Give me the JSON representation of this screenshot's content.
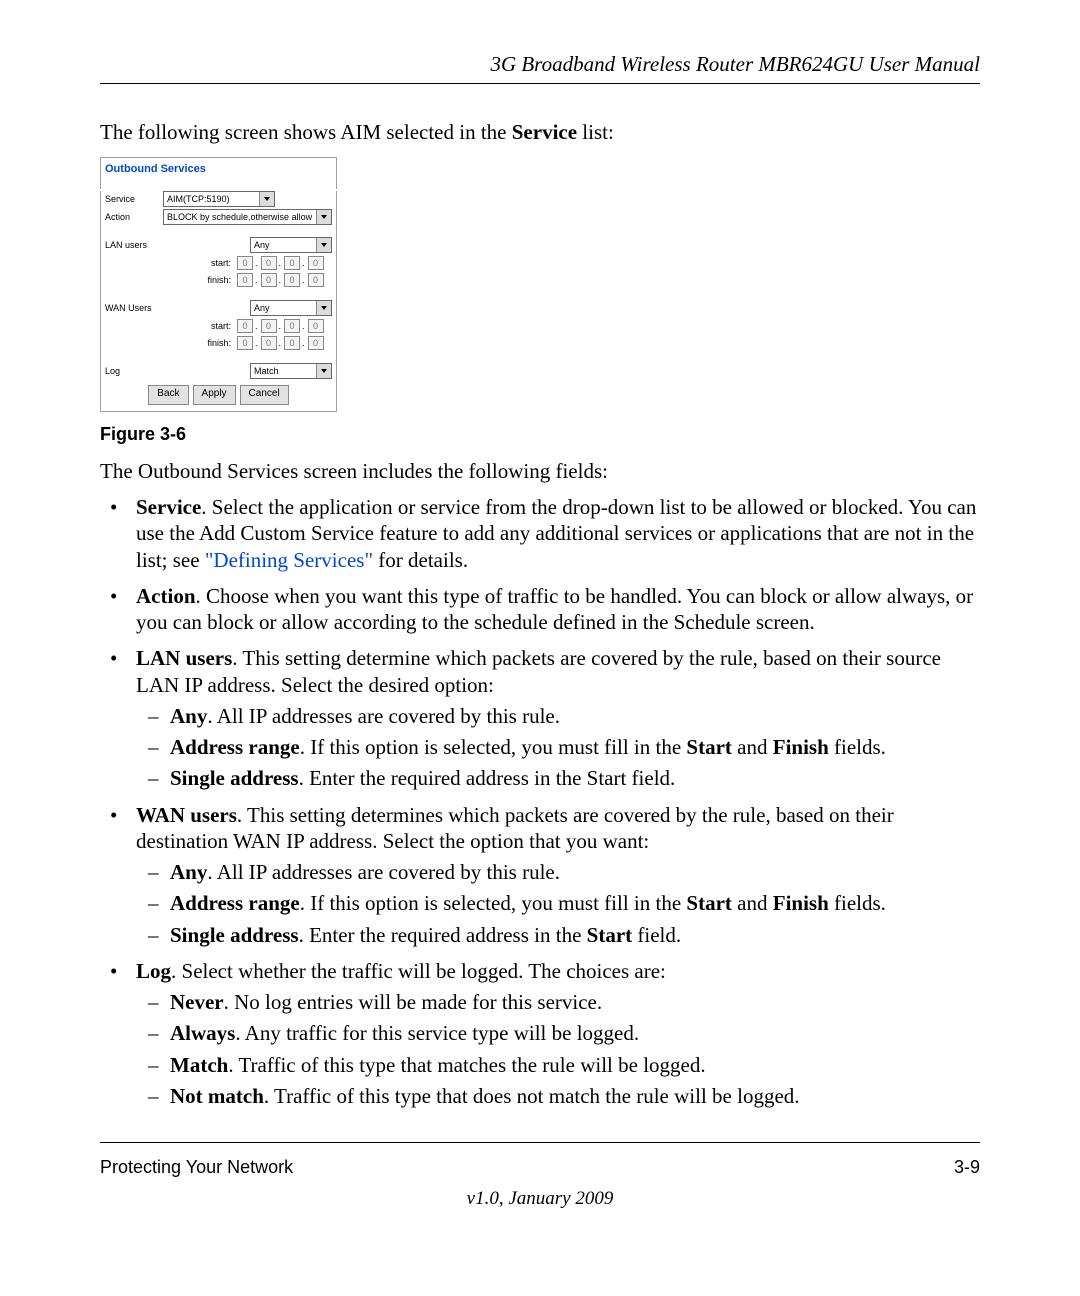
{
  "header": {
    "running_title": "3G Broadband Wireless Router MBR624GU User Manual"
  },
  "intro": {
    "pre": "The following screen shows AIM selected in the ",
    "bold": "Service",
    "post": " list:"
  },
  "figure": {
    "panel_title": "Outbound Services",
    "labels": {
      "service": "Service",
      "action": "Action",
      "lan_users": "LAN users",
      "wan_users": "WAN Users",
      "start": "start:",
      "finish": "finish:",
      "log": "Log"
    },
    "selects": {
      "service": "AIM(TCP:5190)",
      "action": "BLOCK by schedule,otherwise allow",
      "lan_users": "Any",
      "wan_users": "Any",
      "log": "Match"
    },
    "octet": "0",
    "buttons": {
      "back": "Back",
      "apply": "Apply",
      "cancel": "Cancel"
    },
    "caption": "Figure 3-6"
  },
  "body": {
    "lead": "The Outbound Services screen includes the following fields:",
    "service": {
      "term": "Service",
      "text": ". Select the application or service from the drop-down list to be allowed or blocked. You can use the Add Custom Service feature to add any additional services or applications that are not in the list; see ",
      "xref": "\"Defining Services\"",
      "after": " for details."
    },
    "action": {
      "term": "Action",
      "text": ". Choose when you want this type of traffic to be handled. You can block or allow always, or you can block or allow according to the schedule defined in the Schedule screen."
    },
    "lan": {
      "term": "LAN users",
      "text": ". This setting determine which packets are covered by the rule, based on their source LAN IP address. Select the desired option:",
      "any_term": "Any",
      "any_text": ". All IP addresses are covered by this rule.",
      "range_term": "Address range",
      "range_pre": ". If this option is selected, you must fill in the ",
      "range_b1": "Start",
      "range_mid": " and ",
      "range_b2": "Finish",
      "range_post": " fields.",
      "single_term": "Single address",
      "single_text": ". Enter the required address in the Start field."
    },
    "wan": {
      "term": "WAN users",
      "text": ". This setting determines which packets are covered by the rule, based on their destination WAN IP address. Select the option that you want:",
      "any_term": "Any",
      "any_text": ". All IP addresses are covered by this rule.",
      "range_term": "Address range",
      "range_pre": ". If this option is selected, you must fill in the ",
      "range_b1": "Start",
      "range_mid": " and ",
      "range_b2": "Finish",
      "range_post": " fields.",
      "single_term": "Single address",
      "single_pre": ". Enter the required address in the ",
      "single_b": "Start",
      "single_post": " field."
    },
    "log": {
      "term": "Log",
      "text": ". Select whether the traffic will be logged. The choices are:",
      "never_term": "Never",
      "never_text": ". No log entries will be made for this service.",
      "always_term": "Always",
      "always_text": ". Any traffic for this service type will be logged.",
      "match_term": "Match",
      "match_text": ". Traffic of this type that matches the rule will be logged.",
      "notmatch_term": "Not match",
      "notmatch_text": ". Traffic of this type that does not match the rule will be logged."
    }
  },
  "footer": {
    "section": "Protecting Your Network",
    "page": "3-9",
    "version": "v1.0, January 2009"
  }
}
